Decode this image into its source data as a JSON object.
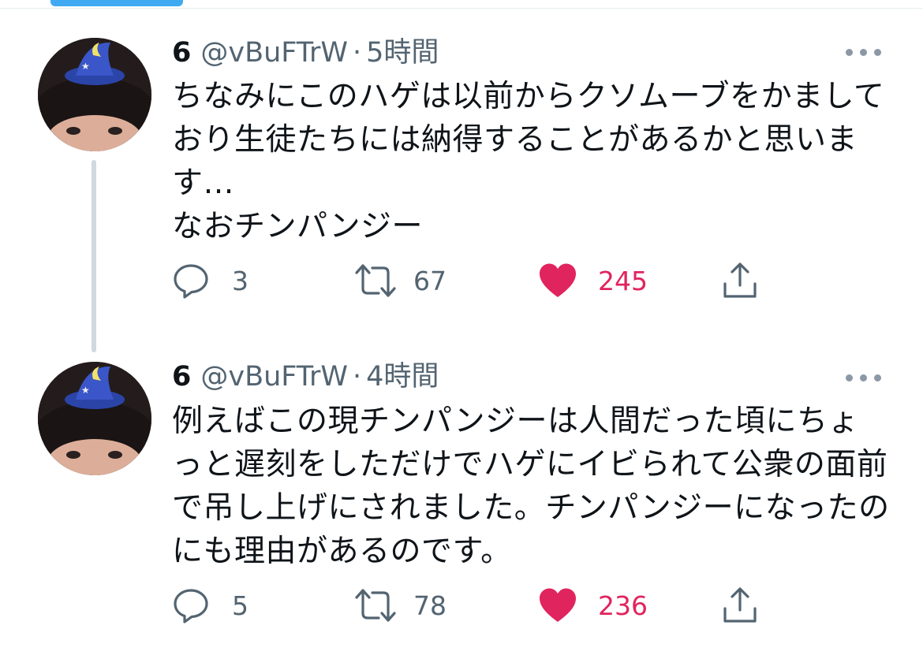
{
  "tweets": [
    {
      "name": "6",
      "handle": "@vBuFTrW",
      "separator": "·",
      "time": "5時間",
      "text": "ちなみにこのハゲは以前からクソムーブをかましており生徒たちには納得することがあるかと思います…\nなおチンパンジー",
      "replies": "3",
      "retweets": "67",
      "likes": "245"
    },
    {
      "name": "6",
      "handle": "@vBuFTrW",
      "separator": "·",
      "time": "4時間",
      "text": "例えばこの現チンパンジーは人間だった頃にちょっと遅刻をしただけでハゲにイビられて公衆の面前で吊し上げにされました。チンパンジーになったのにも理由があるのです。",
      "replies": "5",
      "retweets": "78",
      "likes": "236"
    }
  ],
  "icons": {
    "reply": "reply-icon",
    "retweet": "retweet-icon",
    "like": "heart-icon",
    "share": "share-icon",
    "more": "more-icon"
  },
  "colors": {
    "like_active": "#e0245e",
    "secondary_text": "#536471",
    "thread_line": "#cfd9de"
  }
}
